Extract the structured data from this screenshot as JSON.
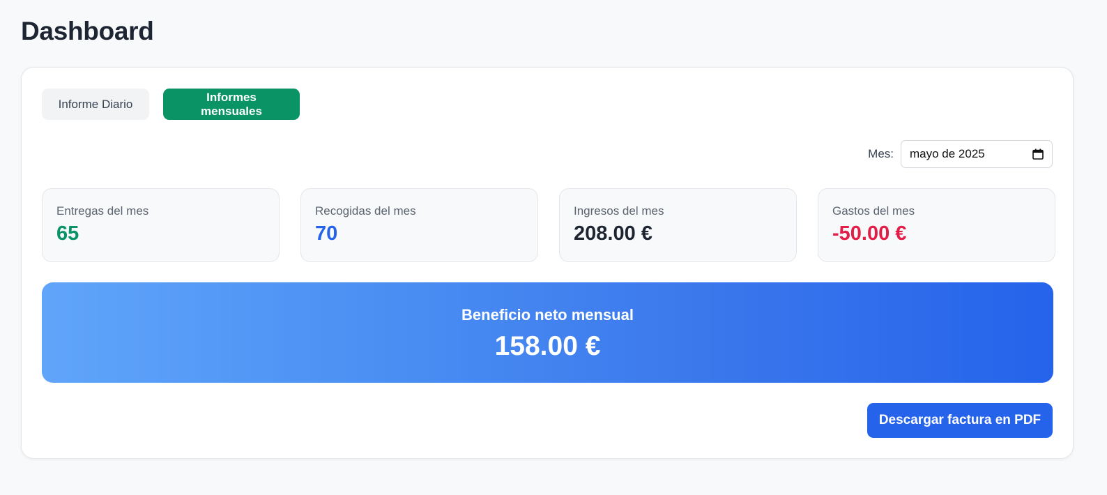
{
  "page": {
    "title": "Dashboard"
  },
  "tabs": [
    {
      "label": "Informe Diario",
      "active": false
    },
    {
      "label": "Informes mensuales",
      "active": true
    }
  ],
  "month_filter": {
    "label": "Mes:",
    "value": "mayo de 2025",
    "icon": "calendar-icon"
  },
  "stats": [
    {
      "label": "Entregas del mes",
      "value": "65",
      "color": "#0a9365"
    },
    {
      "label": "Recogidas del mes",
      "value": "70",
      "color": "#2563eb"
    },
    {
      "label": "Ingresos del mes",
      "value": "208.00 €",
      "color": "#1e2532"
    },
    {
      "label": "Gastos del mes",
      "value": "-50.00 €",
      "color": "#e11d48"
    }
  ],
  "profit": {
    "label": "Beneficio neto mensual",
    "value": "158.00 €"
  },
  "actions": {
    "download_pdf": "Descargar factura en PDF"
  },
  "colors": {
    "accent_green": "#0a9365",
    "accent_blue": "#2563eb"
  }
}
